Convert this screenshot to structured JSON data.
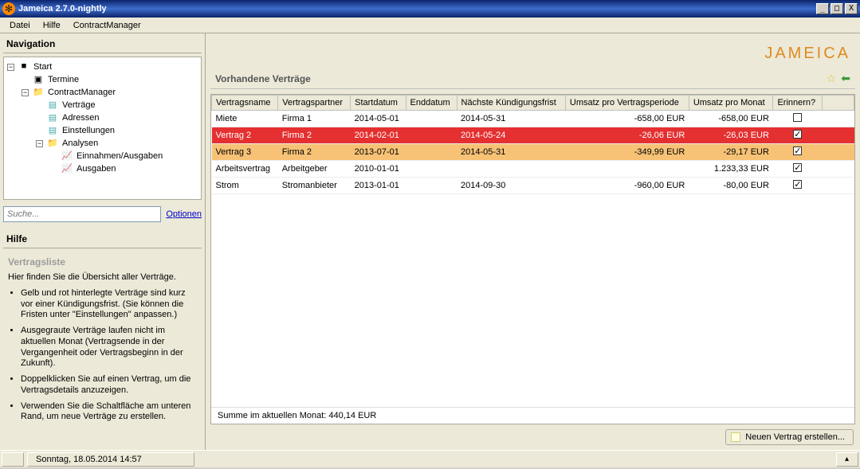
{
  "window": {
    "title": "Jameica 2.7.0-nightly"
  },
  "menu": {
    "items": [
      "Datei",
      "Hilfe",
      "ContractManager"
    ]
  },
  "sidebar": {
    "nav_title": "Navigation",
    "tree": [
      {
        "level": 0,
        "expand": "minus",
        "icon": "app",
        "label": "Start"
      },
      {
        "level": 1,
        "expand": "none",
        "icon": "cal",
        "label": "Termine"
      },
      {
        "level": 1,
        "expand": "minus",
        "icon": "folder",
        "label": "ContractManager"
      },
      {
        "level": 2,
        "expand": "none",
        "icon": "doc",
        "label": "Verträge"
      },
      {
        "level": 2,
        "expand": "none",
        "icon": "doc",
        "label": "Adressen"
      },
      {
        "level": 2,
        "expand": "none",
        "icon": "doc",
        "label": "Einstellungen"
      },
      {
        "level": 2,
        "expand": "minus",
        "icon": "folder",
        "label": "Analysen"
      },
      {
        "level": 3,
        "expand": "none",
        "icon": "chart",
        "label": "Einnahmen/Ausgaben"
      },
      {
        "level": 3,
        "expand": "none",
        "icon": "chart",
        "label": "Ausgaben"
      }
    ],
    "search_placeholder": "Suche...",
    "options_link": "Optionen",
    "help": {
      "title": "Hilfe",
      "heading": "Vertragsliste",
      "intro": "Hier finden Sie die Übersicht aller Verträge.",
      "bullets": [
        "Gelb und rot hinterlegte Verträge sind kurz vor einer Kündigungsfrist. (Sie können die Fristen unter \"Einstellungen\" anpassen.)",
        "Ausgegraute Verträge laufen nicht im aktuellen Monat (Vertragsende in der Vergangenheit oder Vertragsbeginn in der Zukunft).",
        "Doppelklicken Sie auf einen Vertrag, um die Vertragsdetails anzuzeigen.",
        "Verwenden Sie die Schaltfläche am unteren Rand, um neue Verträge zu erstellen."
      ]
    }
  },
  "main": {
    "logo_text": "jameica",
    "section_title": "Vorhandene Verträge",
    "columns": [
      "Vertragsname",
      "Vertragspartner",
      "Startdatum",
      "Enddatum",
      "Nächste Kündigungsfrist",
      "Umsatz pro Vertragsperiode",
      "Umsatz pro Monat",
      "Erinnern?"
    ],
    "rows": [
      {
        "name": "Miete",
        "partner": "Firma 1",
        "start": "2014-05-01",
        "end": "",
        "kuend": "2014-05-31",
        "periode": "-658,00 EUR",
        "monat": "-658,00 EUR",
        "remind": false,
        "rowclass": ""
      },
      {
        "name": "Vertrag 2",
        "partner": "Firma 2",
        "start": "2014-02-01",
        "end": "",
        "kuend": "2014-05-24",
        "periode": "-26,06 EUR",
        "monat": "-26,03 EUR",
        "remind": true,
        "rowclass": "red"
      },
      {
        "name": "Vertrag 3",
        "partner": "Firma 2",
        "start": "2013-07-01",
        "end": "",
        "kuend": "2014-05-31",
        "periode": "-349,99 EUR",
        "monat": "-29,17 EUR",
        "remind": true,
        "rowclass": "orange"
      },
      {
        "name": "Arbeitsvertrag",
        "partner": "Arbeitgeber",
        "start": "2010-01-01",
        "end": "",
        "kuend": "",
        "periode": "",
        "monat": "1.233,33 EUR",
        "remind": true,
        "rowclass": ""
      },
      {
        "name": "Strom",
        "partner": "Stromanbieter",
        "start": "2013-01-01",
        "end": "",
        "kuend": "2014-09-30",
        "periode": "-960,00 EUR",
        "monat": "-80,00 EUR",
        "remind": true,
        "rowclass": ""
      }
    ],
    "footer": "Summe im aktuellen Monat: 440,14 EUR",
    "new_button": "Neuen Vertrag erstellen..."
  },
  "status": {
    "datetime": "Sonntag, 18.05.2014 14:57"
  }
}
